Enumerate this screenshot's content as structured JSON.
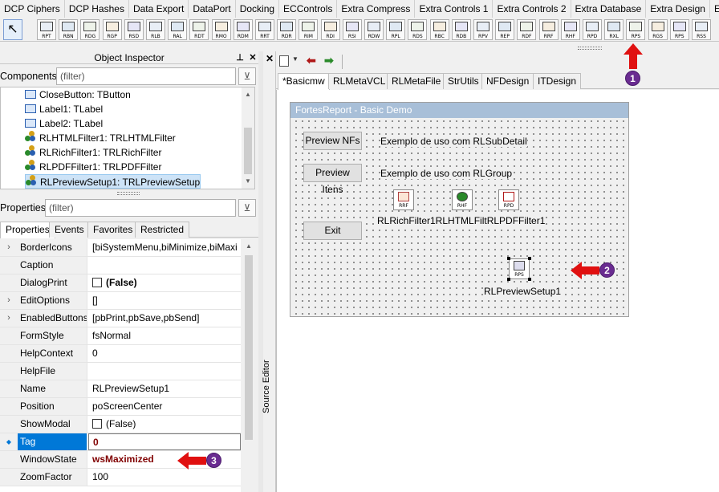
{
  "palette": {
    "tabs": [
      "DCP Ciphers",
      "DCP Hashes",
      "Data Export",
      "DataPort",
      "Docking",
      "ECControls",
      "Extra Compress",
      "Extra Controls 1",
      "Extra Controls 2",
      "Extra Database",
      "Extra Design",
      "Extra"
    ],
    "components": [
      "RPT",
      "RBN",
      "RDG",
      "RGP",
      "RSD",
      "RLB",
      "RAL",
      "RDT",
      "RMO",
      "RDM",
      "RRT",
      "RDR",
      "RIM",
      "RDI",
      "RSI",
      "RDW",
      "RPL",
      "RDS",
      "RBC",
      "RDB",
      "RPV",
      "REP",
      "RDF",
      "RRF",
      "RHF",
      "RPD",
      "RXL",
      "RPS",
      "RGS",
      "RPS",
      "RSS"
    ]
  },
  "object_inspector": {
    "title": "Object Inspector",
    "pin": "⊥",
    "close": "✕",
    "components_label": "Components",
    "components_filter": "(filter)",
    "tree": [
      "CloseButton: TButton",
      "Label1: TLabel",
      "Label2: TLabel",
      "RLHTMLFilter1: TRLHTMLFilter",
      "RLRichFilter1: TRLRichFilter",
      "RLPDFFilter1: TRLPDFFilter",
      "RLPreviewSetup1: TRLPreviewSetup"
    ],
    "properties_label": "Properties",
    "properties_filter": "(filter)",
    "tabs": [
      "Properties",
      "Events",
      "Favorites",
      "Restricted"
    ],
    "rows": [
      {
        "name": "BorderIcons",
        "value": "[biSystemMenu,biMinimize,biMaxi",
        "expand": "›"
      },
      {
        "name": "Caption",
        "value": ""
      },
      {
        "name": "DialogPrint",
        "value": "(False)"
      },
      {
        "name": "EditOptions",
        "value": "[]",
        "expand": "›"
      },
      {
        "name": "EnabledButtons",
        "value": "[pbPrint,pbSave,pbSend]",
        "expand": "›"
      },
      {
        "name": "FormStyle",
        "value": "fsNormal"
      },
      {
        "name": "HelpContext",
        "value": "0"
      },
      {
        "name": "HelpFile",
        "value": ""
      },
      {
        "name": "Name",
        "value": "RLPreviewSetup1"
      },
      {
        "name": "Position",
        "value": "poScreenCenter"
      },
      {
        "name": "ShowModal",
        "value": "(False)"
      },
      {
        "name": "Tag",
        "value": "0",
        "marker": "◆"
      },
      {
        "name": "WindowState",
        "value": "wsMaximized"
      },
      {
        "name": "ZoomFactor",
        "value": "100"
      }
    ]
  },
  "source_editor_label": "Source Editor",
  "editor": {
    "tabs": [
      "*Basicmw",
      "RLMetaVCL",
      "RLMetaFile",
      "StrUtils",
      "NFDesign",
      "ITDesign"
    ],
    "form": {
      "title": "FortesReport - Basic Demo",
      "btn_preview_nfs": "Preview NFs",
      "label_subdetail": "Exemplo de uso com RLSubDetail",
      "btn_preview_itens": "Preview Itens",
      "label_group": "Exemplo de uso com RLGroup",
      "btn_exit": "Exit",
      "comp_rrf": "RRF",
      "comp_rhf": "RHF",
      "comp_rpd": "RPD",
      "comp_labels": "RLRichFilter1RLHTMLFiltRLPDFFilter1",
      "comp_rps": "RPS",
      "comp_rps_label": "RLPreviewSetup1"
    }
  },
  "annotations": [
    "1",
    "2",
    "3"
  ],
  "colors": {
    "annotation_arrow": "#e01010",
    "badge": "#6a2c91",
    "selection": "#0078d7"
  }
}
